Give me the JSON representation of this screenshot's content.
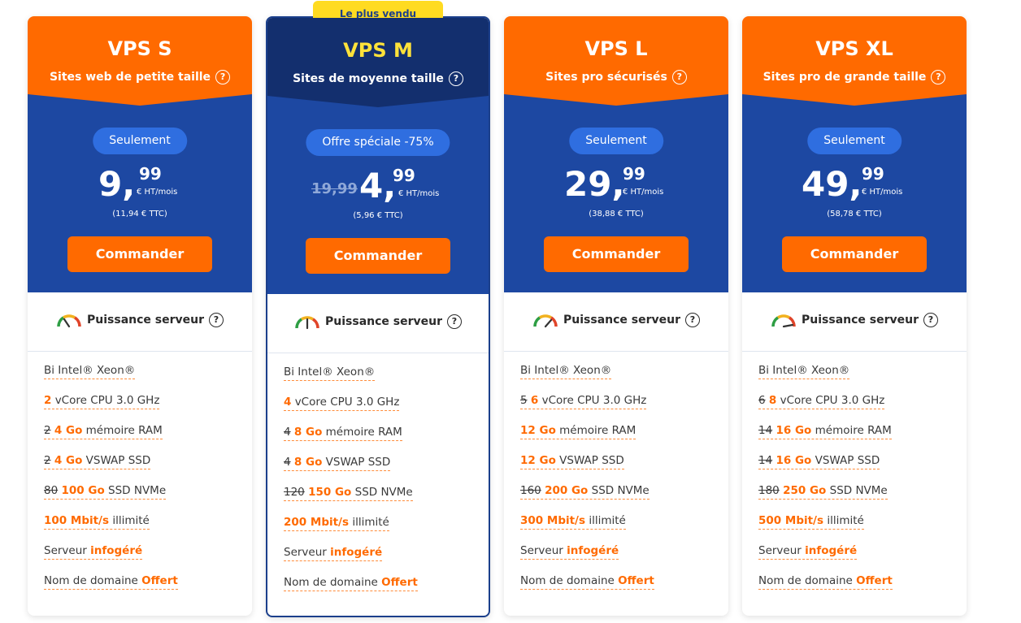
{
  "plans": [
    {
      "name": "VPS S",
      "subtitle": "Sites web de petite taille",
      "pill": "Seulement",
      "old_price": "",
      "amount": "9,",
      "cents": "99",
      "unit": "€ HT/mois",
      "ttc": "(11,94 € TTC)",
      "button": "Commander",
      "power_label": "Puissance serveur",
      "power_level": 0.25,
      "specs": [
        {
          "strike": "",
          "bold": "",
          "plain": "Bi Intel® Xeon®"
        },
        {
          "strike": "",
          "bold": "2",
          "plain": " vCore CPU 3.0 GHz"
        },
        {
          "strike": "2",
          "bold": "4 Go",
          "plain": " mémoire RAM"
        },
        {
          "strike": "2",
          "bold": "4 Go",
          "plain": " VSWAP SSD"
        },
        {
          "strike": "80",
          "bold": "100 Go",
          "plain": " SSD NVMe"
        },
        {
          "strike": "",
          "bold": "100 Mbit/s",
          "plain": " illimité"
        },
        {
          "strike": "",
          "bold": "infogéré",
          "plain": "Serveur ",
          "bold_after": true
        },
        {
          "strike": "",
          "bold": "Offert",
          "plain": "Nom de domaine ",
          "bold_after": true
        }
      ]
    },
    {
      "name": "VPS M",
      "subtitle": "Sites de moyenne taille",
      "badge": "Le plus vendu",
      "pill": "Offre spéciale -75%",
      "old_price": "19,99",
      "amount": "4,",
      "cents": "99",
      "unit": "€ HT/mois",
      "ttc": "(5,96 € TTC)",
      "button": "Commander",
      "power_label": "Puissance serveur",
      "power_level": 0.5,
      "specs": [
        {
          "strike": "",
          "bold": "",
          "plain": "Bi Intel® Xeon®"
        },
        {
          "strike": "",
          "bold": "4",
          "plain": " vCore CPU 3.0 GHz"
        },
        {
          "strike": "4",
          "bold": "8 Go",
          "plain": " mémoire RAM"
        },
        {
          "strike": "4",
          "bold": "8 Go",
          "plain": " VSWAP SSD"
        },
        {
          "strike": "120",
          "bold": "150 Go",
          "plain": " SSD NVMe"
        },
        {
          "strike": "",
          "bold": "200 Mbit/s",
          "plain": " illimité"
        },
        {
          "strike": "",
          "bold": "infogéré",
          "plain": "Serveur ",
          "bold_after": true
        },
        {
          "strike": "",
          "bold": "Offert",
          "plain": "Nom de domaine ",
          "bold_after": true
        }
      ]
    },
    {
      "name": "VPS L",
      "subtitle": "Sites pro sécurisés",
      "pill": "Seulement",
      "old_price": "",
      "amount": "29,",
      "cents": "99",
      "unit": "€ HT/mois",
      "ttc": "(38,88 € TTC)",
      "button": "Commander",
      "power_label": "Puissance serveur",
      "power_level": 0.75,
      "specs": [
        {
          "strike": "",
          "bold": "",
          "plain": "Bi Intel® Xeon®"
        },
        {
          "strike": "5",
          "bold": "6",
          "plain": " vCore CPU 3.0 GHz"
        },
        {
          "strike": "",
          "bold": "12 Go",
          "plain": " mémoire RAM"
        },
        {
          "strike": "",
          "bold": "12 Go",
          "plain": " VSWAP SSD"
        },
        {
          "strike": "160",
          "bold": "200 Go",
          "plain": " SSD NVMe"
        },
        {
          "strike": "",
          "bold": "300 Mbit/s",
          "plain": " illimité"
        },
        {
          "strike": "",
          "bold": "infogéré",
          "plain": "Serveur ",
          "bold_after": true
        },
        {
          "strike": "",
          "bold": "Offert",
          "plain": "Nom de domaine ",
          "bold_after": true
        }
      ]
    },
    {
      "name": "VPS XL",
      "subtitle": "Sites pro de grande taille",
      "pill": "Seulement",
      "old_price": "",
      "amount": "49,",
      "cents": "99",
      "unit": "€ HT/mois",
      "ttc": "(58,78 € TTC)",
      "button": "Commander",
      "power_label": "Puissance serveur",
      "power_level": 0.95,
      "specs": [
        {
          "strike": "",
          "bold": "",
          "plain": "Bi Intel® Xeon®"
        },
        {
          "strike": "6",
          "bold": "8",
          "plain": " vCore CPU 3.0 GHz"
        },
        {
          "strike": "14",
          "bold": "16 Go",
          "plain": " mémoire RAM"
        },
        {
          "strike": "14",
          "bold": "16 Go",
          "plain": " VSWAP SSD"
        },
        {
          "strike": "180",
          "bold": "250 Go",
          "plain": " SSD NVMe"
        },
        {
          "strike": "",
          "bold": "500 Mbit/s",
          "plain": " illimité"
        },
        {
          "strike": "",
          "bold": "infogéré",
          "plain": "Serveur ",
          "bold_after": true
        },
        {
          "strike": "",
          "bold": "Offert",
          "plain": "Nom de domaine ",
          "bold_after": true
        }
      ]
    }
  ],
  "colors": {
    "orange": "#ff6a00",
    "navy": "#132f6e",
    "blue": "#1d48a2",
    "pill": "#2f6ee0",
    "badge": "#ffdb21",
    "featured_name": "#ffe23a"
  },
  "icons": {
    "help": "question-circle-icon",
    "gauge": "speedometer-icon"
  }
}
